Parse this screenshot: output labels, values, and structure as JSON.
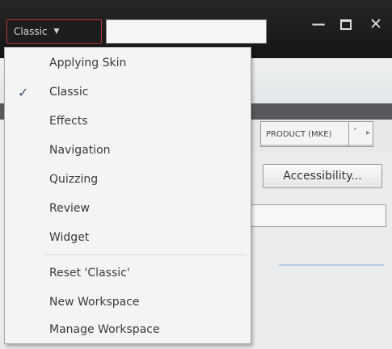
{
  "titlebar": {
    "workspace_label": "Classic",
    "workspace_caret": "▼",
    "minimize_glyph": "—",
    "close_glyph": "✕"
  },
  "menu": {
    "checkmark": "✓",
    "items": [
      {
        "label": "Applying Skin",
        "checked": false
      },
      {
        "label": "Classic",
        "checked": true
      },
      {
        "label": "Effects",
        "checked": false
      },
      {
        "label": "Navigation",
        "checked": false
      },
      {
        "label": "Quizzing",
        "checked": false
      },
      {
        "label": "Review",
        "checked": false
      },
      {
        "label": "Widget",
        "checked": false
      }
    ],
    "actions": [
      {
        "label": "Reset 'Classic'"
      },
      {
        "label": "New Workspace"
      },
      {
        "label": "Manage Workspace"
      }
    ]
  },
  "background": {
    "tab_label": "PRODUCT (MKE)",
    "tab_quote": "\"",
    "tab_more": "▸",
    "accessibility_label": "Accessibility..."
  }
}
